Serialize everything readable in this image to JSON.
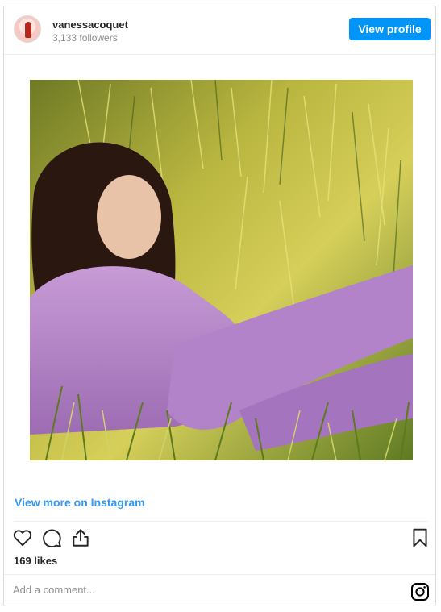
{
  "header": {
    "username": "vanessacoquet",
    "followers": "3,133 followers",
    "view_profile_label": "View profile"
  },
  "post": {
    "view_more_label": "View more on Instagram",
    "likes": "169 likes",
    "comment_placeholder": "Add a comment..."
  },
  "icons": {
    "like": "heart-icon",
    "comment": "comment-icon",
    "share": "share-icon",
    "save": "bookmark-icon",
    "instagram": "instagram-icon"
  },
  "colors": {
    "accent": "#0095f6",
    "link": "#3897f0",
    "text": "#262626",
    "muted": "#8e8e8e",
    "border": "#dbdbdb"
  }
}
